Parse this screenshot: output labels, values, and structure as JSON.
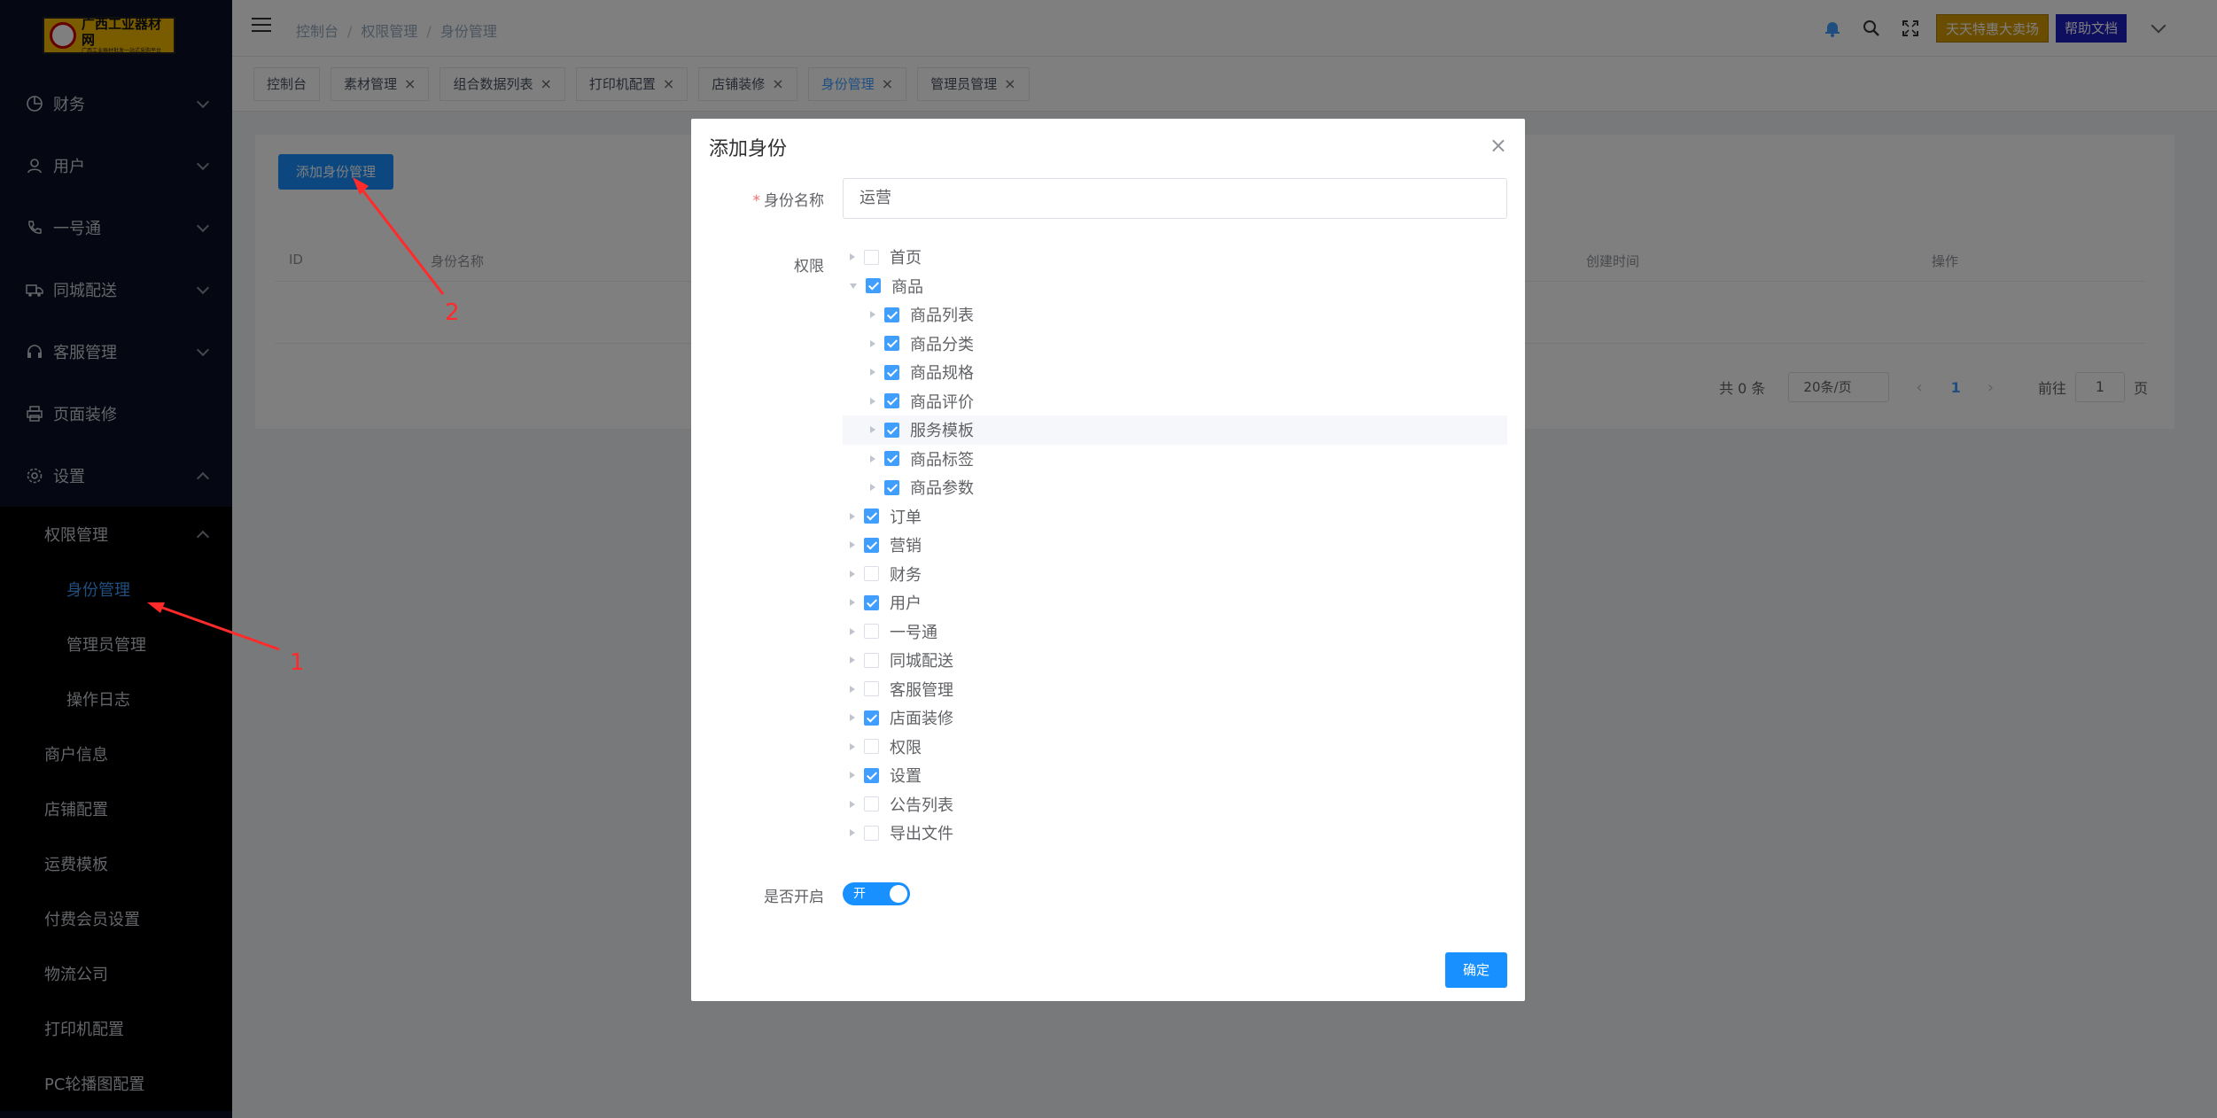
{
  "logo": {
    "title": "广西工业器材网",
    "subtitle": "广西工业器材批发一站式采购平台"
  },
  "sidebar": {
    "items": [
      {
        "label": "财务",
        "icon": "pie-chart-icon"
      },
      {
        "label": "用户",
        "icon": "user-icon"
      },
      {
        "label": "一号通",
        "icon": "phone-icon"
      },
      {
        "label": "同城配送",
        "icon": "truck-icon"
      },
      {
        "label": "客服管理",
        "icon": "headset-icon"
      },
      {
        "label": "页面装修",
        "icon": "printer-icon"
      },
      {
        "label": "设置",
        "icon": "gear-icon"
      }
    ],
    "sub": {
      "permission": "权限管理",
      "identity": "身份管理",
      "admin": "管理员管理",
      "log": "操作日志",
      "merchant": "商户信息",
      "shop": "店铺配置",
      "freight": "运费模板",
      "vip": "付费会员设置",
      "logistics": "物流公司",
      "printer": "打印机配置",
      "pc_banner": "PC轮播图配置"
    }
  },
  "header": {
    "breadcrumb": [
      "控制台",
      "权限管理",
      "身份管理"
    ],
    "sep": "/",
    "sale_btn": "天天特惠大卖场",
    "help_btn": "帮助文档"
  },
  "tabs": [
    {
      "label": "控制台",
      "closable": false
    },
    {
      "label": "素材管理",
      "closable": true
    },
    {
      "label": "组合数据列表",
      "closable": true
    },
    {
      "label": "打印机配置",
      "closable": true
    },
    {
      "label": "店铺装修",
      "closable": true
    },
    {
      "label": "身份管理",
      "closable": true,
      "active": true
    },
    {
      "label": "管理员管理",
      "closable": true
    }
  ],
  "close_glyph": "×",
  "page": {
    "add_button": "添加身份管理",
    "columns": [
      "ID",
      "身份名称",
      "创建时间",
      "操作"
    ],
    "pager": {
      "total": "共 0 条",
      "size": "20条/页",
      "page": "1",
      "goto": "前往",
      "goto_value": "1",
      "page_unit": "页"
    }
  },
  "dialog": {
    "title": "添加身份",
    "name_label": "身份名称",
    "name_value": "运营",
    "perm_label": "权限",
    "enable_label": "是否开启",
    "switch_text": "开",
    "switch_on": true,
    "ok": "确定",
    "tree": [
      {
        "label": "首页",
        "checked": false,
        "level": 0
      },
      {
        "label": "商品",
        "checked": true,
        "level": 0,
        "open": true
      },
      {
        "label": "商品列表",
        "checked": true,
        "level": 1
      },
      {
        "label": "商品分类",
        "checked": true,
        "level": 1
      },
      {
        "label": "商品规格",
        "checked": true,
        "level": 1
      },
      {
        "label": "商品评价",
        "checked": true,
        "level": 1
      },
      {
        "label": "服务模板",
        "checked": true,
        "level": 1,
        "hover": true
      },
      {
        "label": "商品标签",
        "checked": true,
        "level": 1
      },
      {
        "label": "商品参数",
        "checked": true,
        "level": 1
      },
      {
        "label": "订单",
        "checked": true,
        "level": 0
      },
      {
        "label": "营销",
        "checked": true,
        "level": 0
      },
      {
        "label": "财务",
        "checked": false,
        "level": 0
      },
      {
        "label": "用户",
        "checked": true,
        "level": 0
      },
      {
        "label": "一号通",
        "checked": false,
        "level": 0
      },
      {
        "label": "同城配送",
        "checked": false,
        "level": 0
      },
      {
        "label": "客服管理",
        "checked": false,
        "level": 0
      },
      {
        "label": "店面装修",
        "checked": true,
        "level": 0
      },
      {
        "label": "权限",
        "checked": false,
        "level": 0
      },
      {
        "label": "设置",
        "checked": true,
        "level": 0
      },
      {
        "label": "公告列表",
        "checked": false,
        "level": 0
      },
      {
        "label": "导出文件",
        "checked": false,
        "level": 0
      }
    ]
  },
  "annotations": {
    "one": "1",
    "two": "2"
  },
  "colors": {
    "primary": "#1890ff",
    "sidebar_bg": "#0a0f24",
    "annotation": "#ff2a2a"
  }
}
